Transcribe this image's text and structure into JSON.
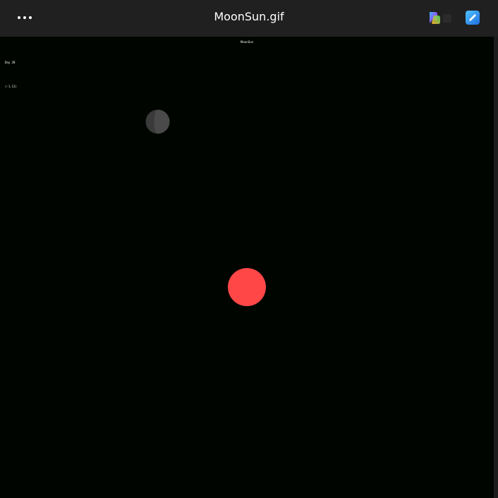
{
  "window": {
    "title": "MoonSun.gif",
    "more_icon": "more-horizontal-icon",
    "copilot_icon": "copilot-icon",
    "edit_icon": "edit-image-icon"
  },
  "gif": {
    "heading": "MoonSun",
    "day_text": "Day 28",
    "coord_text": "(-1.11)",
    "background_color": "#000500",
    "moon_color": "#4a4a4a",
    "moon_shadow_color": "#3a3a3a",
    "sun_color": "#ff4747",
    "moon_illumination": 0.35
  }
}
